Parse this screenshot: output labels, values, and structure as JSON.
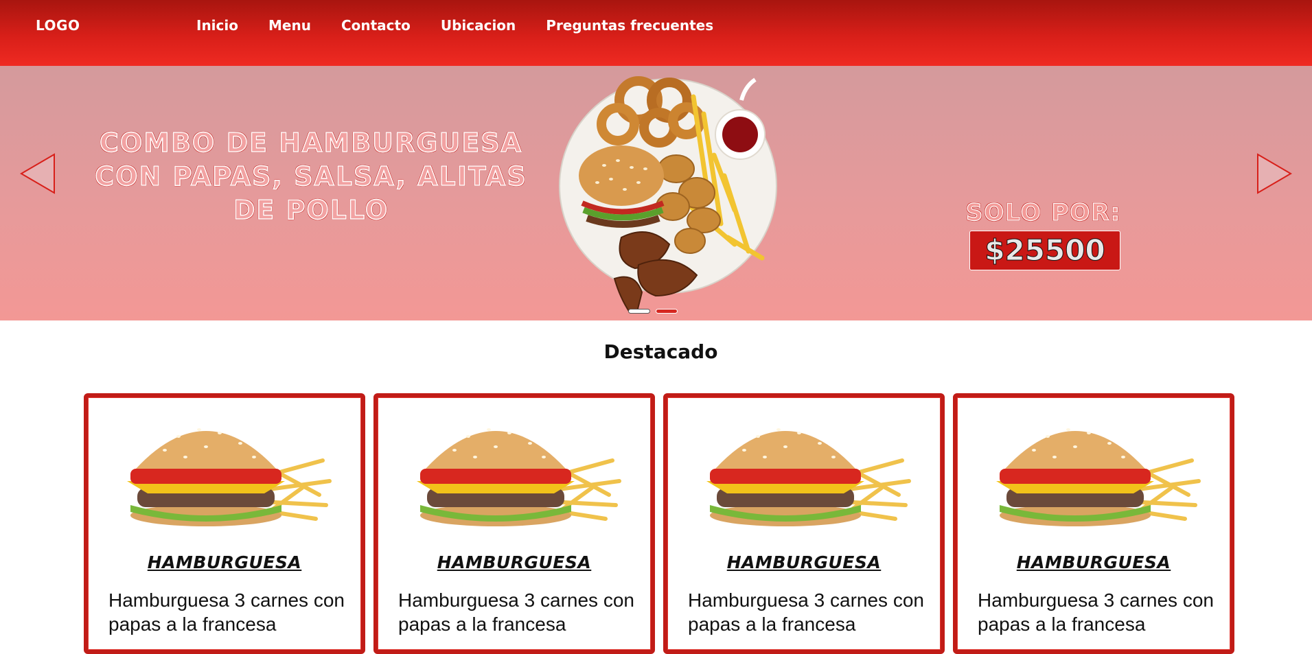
{
  "header": {
    "logo": "LOGO",
    "nav": [
      "Inicio",
      "Menu",
      "Contacto",
      "Ubicacion",
      "Preguntas frecuentes"
    ]
  },
  "hero": {
    "title": "COMBO DE HAMBURGUESA CON PAPAS, SALSA, ALITAS DE POLLO",
    "price_label": "SOLO POR:",
    "price": "$25500",
    "slide_count": 2,
    "active_slide": 1
  },
  "featured": {
    "title": "Destacado",
    "cards": [
      {
        "title": "HAMBURGUESA",
        "description": "Hamburguesa 3 carnes con papas a la francesa"
      },
      {
        "title": "HAMBURGUESA",
        "description": "Hamburguesa 3 carnes con papas a la francesa"
      },
      {
        "title": "HAMBURGUESA",
        "description": "Hamburguesa 3 carnes con papas a la francesa"
      },
      {
        "title": "HAMBURGUESA",
        "description": "Hamburguesa 3 carnes con papas a la francesa"
      }
    ]
  },
  "colors": {
    "brand_red": "#d81f19",
    "hero_pink": "#e59a9b"
  }
}
